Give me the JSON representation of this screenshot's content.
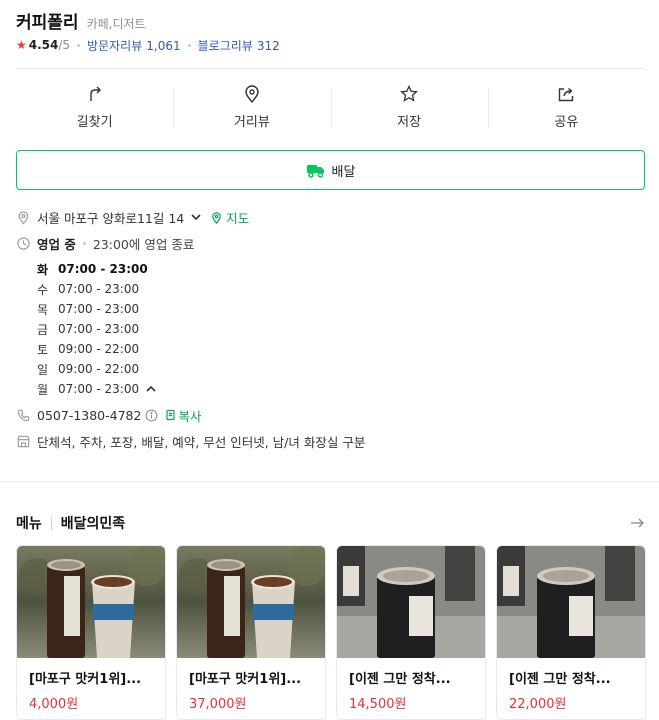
{
  "place": {
    "name": "커피폴리",
    "category": "카페,디저트",
    "rating": "4.54",
    "rating_max": "/5",
    "visitor_review_label": "방문자리뷰",
    "visitor_review_count": "1,061",
    "blog_review_label": "블로그리뷰",
    "blog_review_count": "312"
  },
  "actions": [
    {
      "label": "길찾기",
      "icon": "directions-icon"
    },
    {
      "label": "거리뷰",
      "icon": "street-view-icon"
    },
    {
      "label": "저장",
      "icon": "star-outline-icon"
    },
    {
      "label": "공유",
      "icon": "share-icon"
    }
  ],
  "delivery": {
    "label": "배달",
    "icon": "delivery-truck-icon"
  },
  "info": {
    "address": "서울 마포구 양화로11길 14",
    "map_label": "지도",
    "status": "영업 중",
    "close_text": "23:00에 영업 종료",
    "hours": [
      {
        "day": "화",
        "time": "07:00 - 23:00"
      },
      {
        "day": "수",
        "time": "07:00 - 23:00"
      },
      {
        "day": "목",
        "time": "07:00 - 23:00"
      },
      {
        "day": "금",
        "time": "07:00 - 23:00"
      },
      {
        "day": "토",
        "time": "09:00 - 22:00"
      },
      {
        "day": "일",
        "time": "09:00 - 22:00"
      },
      {
        "day": "월",
        "time": "07:00 - 23:00"
      }
    ],
    "phone": "0507-1380-4782",
    "copy_label": "복사",
    "amenities": "단체석, 주차, 포장, 배달, 예약, 무선 인터넷, 남/녀 화장실 구분"
  },
  "menu": {
    "title": "메뉴",
    "source": "배달의민족",
    "items": [
      {
        "name": "[마포구 맛커1위]...",
        "price": "4,000원"
      },
      {
        "name": "[마포구 맛커1위]...",
        "price": "37,000원"
      },
      {
        "name": "[이젠 그만 정착...",
        "price": "14,500원"
      },
      {
        "name": "[이젠 그만 정착...",
        "price": "22,000원"
      }
    ]
  },
  "colors": {
    "accent_green": "#03c75a",
    "price_red": "#e2323a",
    "link_blue": "#2f5bb9",
    "star_red": "#f2363d"
  }
}
